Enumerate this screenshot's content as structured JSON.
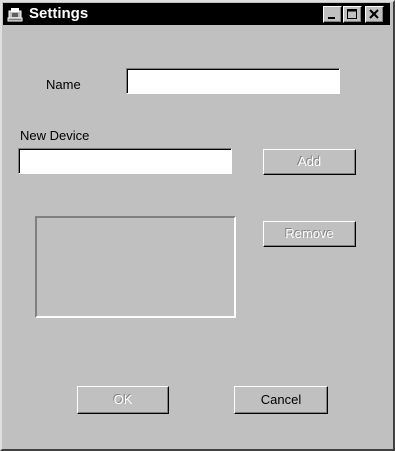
{
  "window": {
    "title": "Settings",
    "icon": "app-icon",
    "controls": {
      "minimize_icon": "minimize-icon",
      "maximize_icon": "maximize-icon",
      "close_icon": "close-icon"
    }
  },
  "form": {
    "name_label": "Name",
    "name_value": "",
    "new_device_label": "New Device",
    "new_device_value": "",
    "add_label": "Add",
    "remove_label": "Remove",
    "device_list": [],
    "ok_label": "OK",
    "cancel_label": "Cancel"
  }
}
